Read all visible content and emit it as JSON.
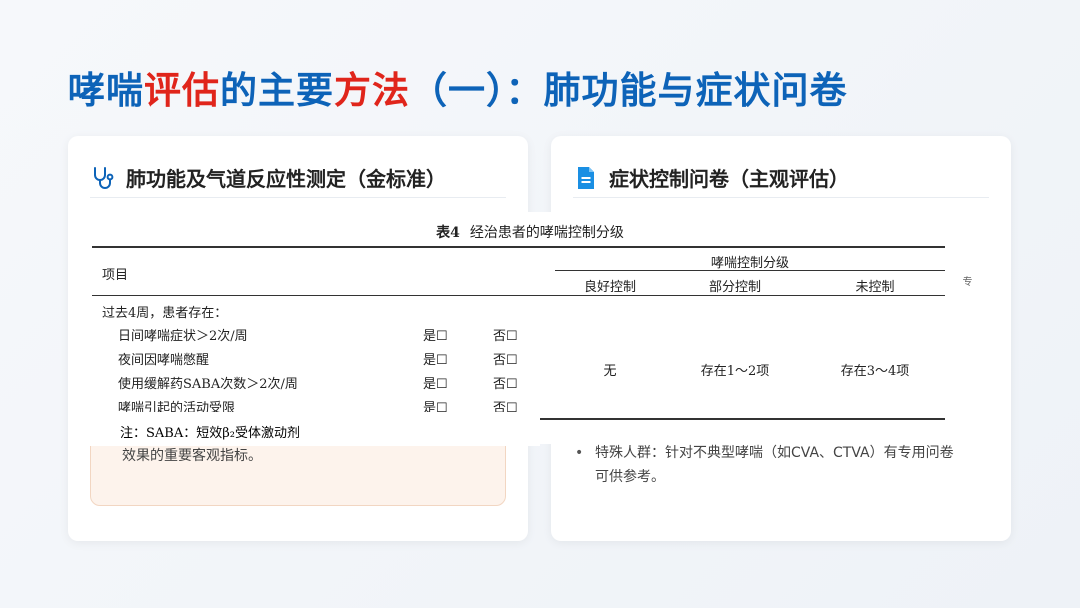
{
  "title": {
    "p1": "哮喘",
    "p2": "评估",
    "p3": "的主要",
    "p4": "方法",
    "p5": "（一）：肺功能与症状问卷"
  },
  "left_card": {
    "heading": "肺功能及气道反应性测定（金标准）",
    "icon": "stethoscope-icon",
    "note": "效果的重要客观指标。"
  },
  "right_card": {
    "heading": "症状控制问卷（主观评估）",
    "icon": "document-icon",
    "bullet_line1": "特殊人群：针对不典型哮喘（如CVA、CTVA）有专用问卷",
    "bullet_line2": "可供参考。"
  },
  "table": {
    "caption_no": "表4",
    "caption": "经治患者的哮喘控制分级",
    "col_item": "项目",
    "group_header": "哮喘控制分级",
    "levels": [
      "良好控制",
      "部分控制",
      "未控制"
    ],
    "section": "过去4周，患者存在：",
    "rows": [
      {
        "label": "日间哮喘症状＞2次/周",
        "yes": "是☐",
        "no": "否☐"
      },
      {
        "label": "夜间因哮喘憋醒",
        "yes": "是☐",
        "no": "否☐"
      },
      {
        "label": "使用缓解药SABA次数＞2次/周",
        "yes": "是☐",
        "no": "否☐"
      },
      {
        "label": "哮喘引起的活动受限",
        "yes": "是☐",
        "no": "否☐"
      }
    ],
    "level_values": [
      "无",
      "存在1～2项",
      "存在3～4项"
    ],
    "footnote": "注：SABA：短效β₂受体激动剂",
    "edge_glyph": "专"
  },
  "colors": {
    "blue": "#0d63b8",
    "red": "#e0251b"
  }
}
